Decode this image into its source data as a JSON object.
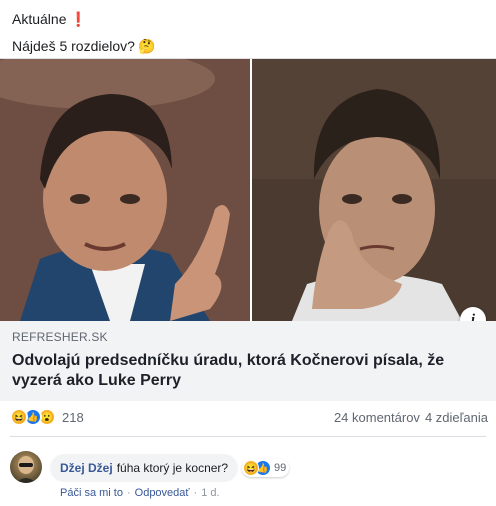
{
  "post": {
    "line1": "Aktuálne",
    "line1_emoji": "❗",
    "line2": "Nájdeš 5 rozdielov?",
    "line2_emoji": "🤔"
  },
  "link_card": {
    "domain": "REFRESHER.SK",
    "title": "Odvolajú predsedníčku úradu, ktorá Kočnerovi písala, že vyzerá ako Luke Perry",
    "info_label": "i"
  },
  "reactions": {
    "icons": [
      "haha-icon",
      "like-icon",
      "wow-icon"
    ],
    "count": "218",
    "comments": "24 komentárov",
    "shares": "4 zdieľania"
  },
  "comment": {
    "author": "Džej Džej",
    "text": "fúha ktorý je kocner?",
    "reaction_count": "99",
    "like_action": "Páči sa mi to",
    "reply_action": "Odpovedať",
    "separator": "·",
    "time": "1 d."
  },
  "colors": {
    "link_blue": "#385898",
    "muted": "#606770",
    "like_blue": "#1877f2",
    "reaction_yellow": "#f7b125"
  }
}
